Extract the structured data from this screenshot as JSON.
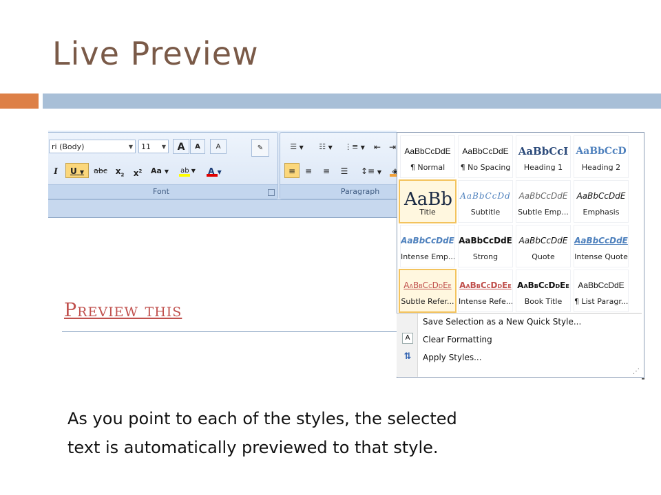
{
  "slide": {
    "title": "Live Preview",
    "preview_heading": "Preview this",
    "body_line1": "As you point to each of the styles, the selected",
    "body_line2": "text is automatically previewed to that style."
  },
  "ribbon": {
    "font_name": "ri (Body)",
    "font_size": "11",
    "font_group_label": "Font",
    "paragraph_group_label": "Paragraph",
    "buttons": {
      "grow": "A",
      "shrink": "A",
      "clear_format": "A",
      "italic": "I",
      "underline": "U",
      "strikethrough": "abc",
      "subscript": "x",
      "superscript": "x",
      "change_case": "Aa",
      "highlight": "ab",
      "font_color": "A",
      "pilcrow": "¶"
    }
  },
  "styles": [
    {
      "sample": "AaBbCcDdE",
      "label": "¶ Normal"
    },
    {
      "sample": "AaBbCcDdE",
      "label": "¶ No Spacing"
    },
    {
      "sample": "AaBbCcI",
      "label": "Heading 1"
    },
    {
      "sample": "AaBbCcD",
      "label": "Heading 2"
    },
    {
      "sample": "AaBb",
      "label": "Title"
    },
    {
      "sample": "AaBbCcDd",
      "label": "Subtitle"
    },
    {
      "sample": "AaBbCcDdE",
      "label": "Subtle Emp..."
    },
    {
      "sample": "AaBbCcDdE",
      "label": "Emphasis"
    },
    {
      "sample": "AaBbCcDdE",
      "label": "Intense Emp..."
    },
    {
      "sample": "AaBbCcDdE",
      "label": "Strong"
    },
    {
      "sample": "AaBbCcDdE",
      "label": "Quote"
    },
    {
      "sample": "AaBbCcDdE",
      "label": "Intense Quote"
    },
    {
      "sample": "AaBbCcDdEe",
      "label": "Subtle Refer..."
    },
    {
      "sample": "AaBbCcDdEe",
      "label": "Intense Refe..."
    },
    {
      "sample": "AaBbCcDdEe",
      "label": "Book Title"
    },
    {
      "sample": "AaBbCcDdE",
      "label": "¶ List Paragr..."
    }
  ],
  "menu": {
    "save_selection": "Save Selection as a New Quick Style...",
    "clear_formatting": "Clear Formatting",
    "apply_styles": "Apply Styles..."
  },
  "colors": {
    "title": "#7a5a48",
    "accent_orange": "#dd8047",
    "accent_blue": "#a8bfd7",
    "heading_red": "#c0504d",
    "selection_gold": "#f3c35d"
  },
  "icons": [
    "dropdown-arrow-icon",
    "bullets-icon",
    "numbering-icon",
    "align-left-icon",
    "align-center-icon",
    "align-right-icon",
    "justify-icon",
    "line-spacing-icon",
    "shading-icon",
    "borders-icon",
    "sort-icon",
    "pilcrow-icon",
    "clear-format-icon",
    "apply-styles-icon",
    "resize-grip-icon"
  ]
}
